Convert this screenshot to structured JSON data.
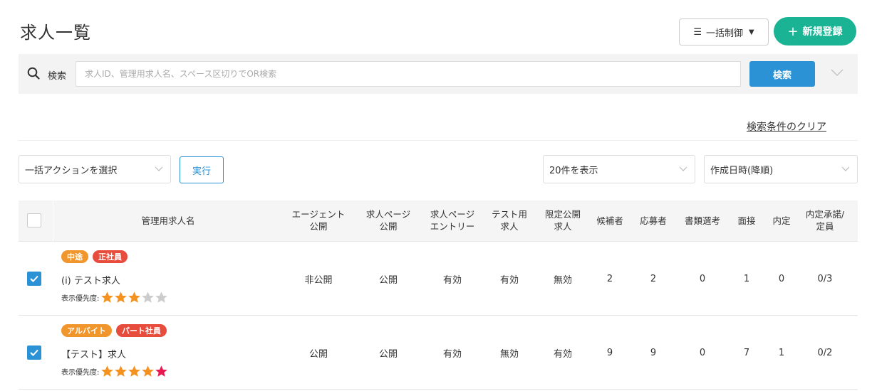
{
  "header": {
    "title": "求人一覧",
    "bulk_control_label": "一括制御",
    "new_button_label": "新規登録"
  },
  "search": {
    "label": "検索",
    "placeholder": "求人ID、管理用求人名、スペース区切りでOR検索",
    "value": "",
    "button_label": "検索",
    "clear_label": "検索条件のクリア"
  },
  "toolbar": {
    "bulk_action_select": "一括アクションを選択",
    "execute_label": "実行",
    "page_size_select": "20件を表示",
    "sort_select": "作成日時(降順)"
  },
  "table": {
    "columns": [
      "管理用求人名",
      "エージェント\n公開",
      "求人ページ\n公開",
      "求人ページ\nエントリー",
      "テスト用\n求人",
      "限定公開\n求人",
      "候補者",
      "応募者",
      "書類選考",
      "面接",
      "内定",
      "内定承諾/\n定員"
    ],
    "priority_label": "表示優先度:",
    "rows": [
      {
        "checked": true,
        "tags": [
          {
            "label": "中途",
            "color": "#f0962c"
          },
          {
            "label": "正社員",
            "color": "#e74c3c"
          }
        ],
        "name": "(i) テスト求人",
        "priority": 3,
        "agent_public": "非公開",
        "job_page_public": "公開",
        "job_page_entry": "有効",
        "test_job": "有効",
        "limited_public": "無効",
        "candidates": "2",
        "applicants": "2",
        "document_screening": "0",
        "interview": "1",
        "offer": "0",
        "accepted_capacity": "0/3"
      },
      {
        "checked": true,
        "tags": [
          {
            "label": "アルバイト",
            "color": "#f0962c"
          },
          {
            "label": "パート社員",
            "color": "#e74c3c"
          }
        ],
        "name": "【テスト】求人",
        "priority": 5,
        "agent_public": "公開",
        "job_page_public": "公開",
        "job_page_entry": "有効",
        "test_job": "無効",
        "limited_public": "有効",
        "candidates": "9",
        "applicants": "9",
        "document_screening": "0",
        "interview": "7",
        "offer": "1",
        "accepted_capacity": "0/2"
      }
    ]
  },
  "colors": {
    "primary_blue": "#2b93d5",
    "new_button_green": "#1ab394",
    "star_orange": "#f5911e",
    "star_pink": "#e8194f",
    "star_empty": "#cccccc"
  }
}
